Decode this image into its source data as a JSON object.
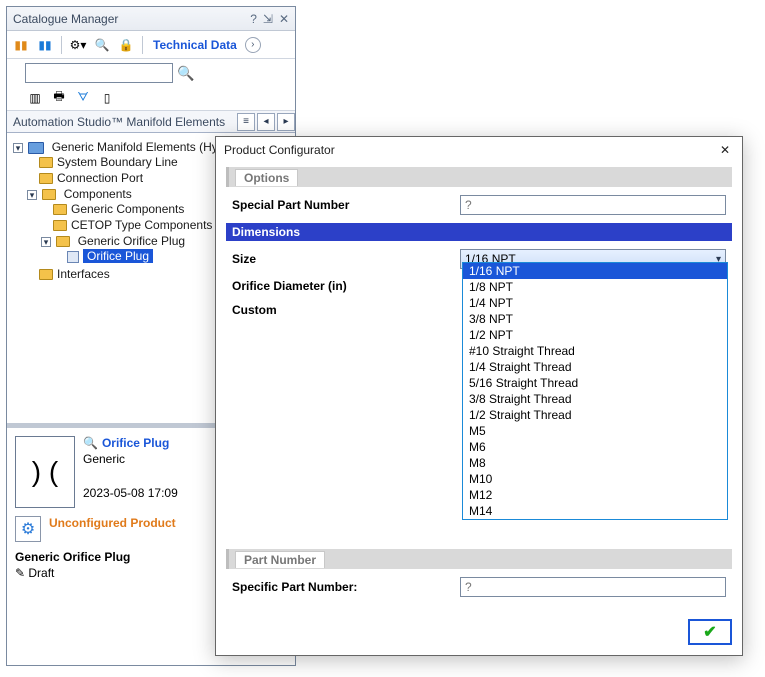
{
  "catalog": {
    "title": "Catalogue Manager",
    "tech_data": "Technical Data",
    "search_placeholder": "",
    "tab_label": "Automation Studio™ Manifold Elements",
    "tree": {
      "root": "Generic Manifold Elements (Hyd",
      "n0": "System Boundary Line",
      "n1": "Connection Port",
      "n2": "Components",
      "n2a": "Generic Components",
      "n2b": "CETOP Type Components",
      "n2c": "Generic Orifice Plug",
      "n2c1": "Orifice Plug",
      "n3": "Interfaces"
    },
    "preview": {
      "title": "Orifice Plug",
      "subtitle": "Generic",
      "date": "2023-05-08 17:09",
      "unconf": "Unconfigured Product",
      "name": "Generic Orifice Plug",
      "draft": "Draft"
    }
  },
  "dialog": {
    "title": "Product Configurator",
    "sec_options": "Options",
    "sec_dimensions": "Dimensions",
    "sec_partnum": "Part Number",
    "lbl_special": "Special Part Number",
    "lbl_size": "Size",
    "lbl_orifice": "Orifice Diameter (in)",
    "lbl_custom": "Custom",
    "lbl_specific": "Specific Part Number:",
    "val_special": "?",
    "val_size": "1/16 NPT",
    "val_specific": "?",
    "size_options": [
      "1/16 NPT",
      "1/8 NPT",
      "1/4 NPT",
      "3/8 NPT",
      "1/2 NPT",
      "#10 Straight Thread",
      "1/4 Straight Thread",
      "5/16 Straight Thread",
      "3/8 Straight Thread",
      "1/2 Straight Thread",
      "M5",
      "M6",
      "M8",
      "M10",
      "M12",
      "M14"
    ]
  }
}
